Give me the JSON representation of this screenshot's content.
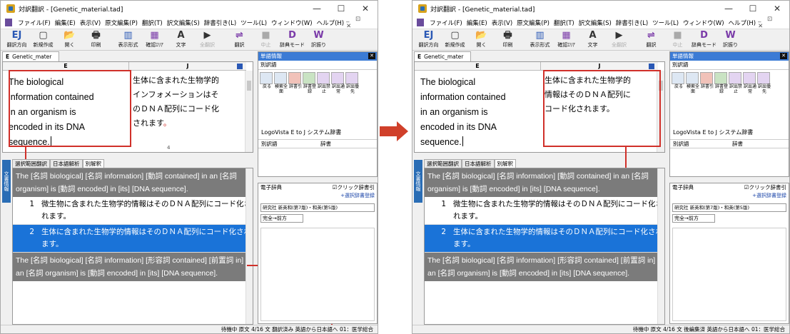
{
  "window": {
    "title": "対訳翻訳 - [Genetic_material.tad]",
    "controls": [
      "—",
      "☐",
      "✕"
    ]
  },
  "menu": {
    "items": [
      "ファイル(F)",
      "編集(E)",
      "表示(V)",
      "原文編集(P)",
      "翻訳(T)",
      "訳文編集(S)",
      "辞書引き(L)",
      "ツール(L)",
      "ウィンドウ(W)",
      "ヘルプ(H)"
    ],
    "right": "_ ⊡ ✕"
  },
  "toolbar": {
    "buttons": [
      {
        "label": "翻訳方向",
        "icon": "EJ"
      },
      {
        "label": "新規作成",
        "icon": "▢"
      },
      {
        "label": "開く",
        "icon": "📂"
      },
      {
        "label": "印刷",
        "icon": "🖶"
      },
      {
        "label": "表示形式",
        "icon": "▥"
      },
      {
        "label": "確認ｴﾘｱ",
        "icon": "▦"
      },
      {
        "label": "文字",
        "icon": "A"
      },
      {
        "label": "全翻訳",
        "icon": "▶"
      },
      {
        "label": "翻訳",
        "icon": "⇌"
      },
      {
        "label": "中止",
        "icon": "■"
      },
      {
        "label": "辞典モード",
        "icon": "D"
      },
      {
        "label": "訳振り",
        "icon": "W"
      }
    ]
  },
  "doc_tab": {
    "letter": "E",
    "name": "Genetic_mater"
  },
  "editor": {
    "col_e": "E",
    "col_j": "J",
    "source_lines": [
      "The biological",
      "information contained",
      "in an organism is",
      "encoded in its DNA",
      "sequence."
    ],
    "target_before": [
      "生体に含まれた生物学的",
      "インフォメーションはそ",
      "のＤＮＡ配列にコード化",
      "されます",
      "。"
    ],
    "target_after": [
      "生体に含まれた生物学的",
      "情報はそのＤＮＡ配列に",
      "コード化されます。"
    ],
    "page": "4"
  },
  "lower_tabs": [
    "選択範囲翻訳",
    "日本語解析",
    "別解釈"
  ],
  "side_label": "文書情報",
  "results": {
    "gray1_before": "The [名詞 biological] [名詞 information] [動詞 contained] in an [名詞 organism] is [動詞 encoded] in [its] [DNA sequence].",
    "gray1_after": "The [名詞 biological] [名詞 information] [動詞 contained] in an [名詞 organism] is [動詞 encoded] in [its] [DNA sequence].",
    "row1_num": "1",
    "row1_text": "微生物に含まれた生物学的情報はそのＤＮＡ配列にコード化されます。",
    "row2_num": "2",
    "row2_text": "生体に含まれた生物学的情報はそのＤＮＡ配列にコード化されます。",
    "gray2": "The [名詞 biological] [名詞 information] [形容詞 contained] [前置詞 in] an [名詞 organism] is [動詞 encoded] in [its] [DNA sequence]."
  },
  "word_info": {
    "header": "単語情報",
    "sub": "別訳語",
    "icon_labels": [
      "戻る",
      "検索全面",
      "辞書引",
      "辞書登録",
      "訳出禁止",
      "訳出通常",
      "訳出優先"
    ],
    "engine": "LogoVista E to J システム辞書",
    "col1": "別訳語",
    "col2": "辞書"
  },
  "e_dict": {
    "header": "電子辞典",
    "check": "☑クリック辞書引",
    "register": "+選択辞書登録",
    "dictionary": "研究社 新英和(第7版)・和英(第5版)",
    "match": "完全→前方"
  },
  "status": {
    "left": "待機中 原文 4/16 文 翻訳済み 英語から日本語へ 01：医学総合",
    "right": "待機中 原文 4/16 文 後編集済 英語から日本語へ 01：医学総合"
  },
  "colors": {
    "highlight_red": "#d0302a",
    "selection_blue": "#1a73d8",
    "gray_row": "#7b7b7b",
    "panel_blue": "#3b7bd5"
  }
}
